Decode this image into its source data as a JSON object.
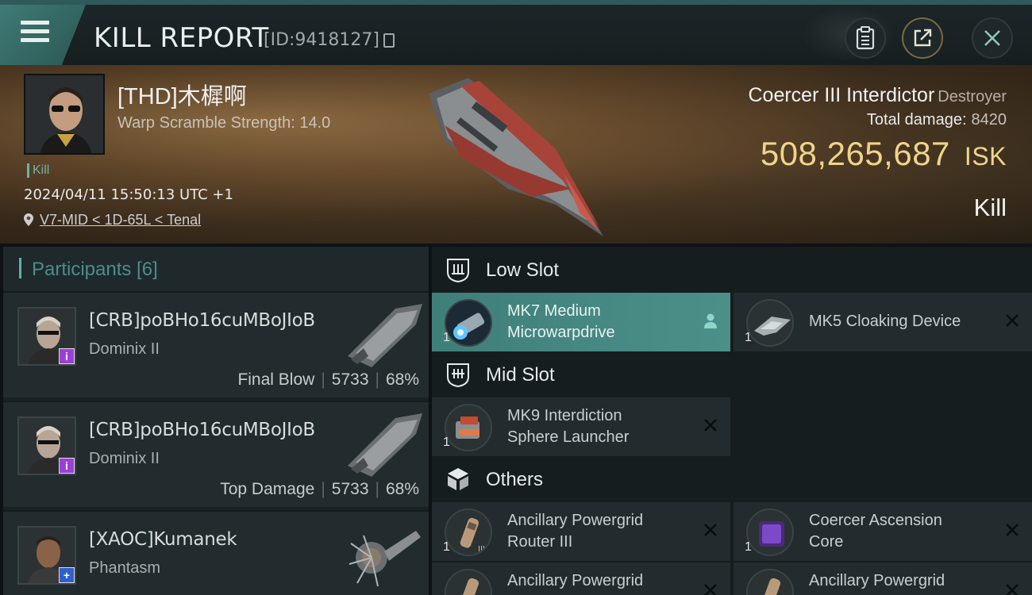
{
  "header": {
    "title": "KILL REPORT",
    "report_id": "[ID:9418127]",
    "icons": [
      "menu-icon",
      "copy-icon",
      "clipboard-icon",
      "share-icon",
      "close-icon"
    ]
  },
  "victim": {
    "name": "[THD]木樨啊",
    "warp_scramble": "Warp Scramble Strength: 14.0",
    "kill_tag": "Kill",
    "datetime": "2024/04/11 15:50:13 UTC +1",
    "location": "V7-MID < 1D-65L < Tenal",
    "ship_name": "Coercer III Interdictor",
    "ship_class": "Destroyer",
    "total_damage_label": "Total damage:",
    "total_damage": "8420",
    "isk_value": "508,265,687",
    "isk_unit": "ISK",
    "result": "Kill"
  },
  "participants": {
    "title": "Participants [6]",
    "items": [
      {
        "name": "[CRB]poBHo16cuMBoJIoB",
        "ship": "Dominix II",
        "role": "Final Blow",
        "damage": "5733",
        "percent": "68%",
        "badge": "i",
        "badge_color": "#9b3fd6"
      },
      {
        "name": "[CRB]poBHo16cuMBoJIoB",
        "ship": "Dominix II",
        "role": "Top Damage",
        "damage": "5733",
        "percent": "68%",
        "badge": "i",
        "badge_color": "#9b3fd6"
      },
      {
        "name": "[XAOC]Kumanek",
        "ship": "Phantasm",
        "role": "",
        "damage": "",
        "percent": "",
        "badge": "+",
        "badge_color": "#2f5fd0"
      }
    ]
  },
  "fitting": {
    "low_slot": {
      "label": "Low Slot",
      "modules": [
        {
          "name_line1": "MK7 Medium",
          "name_line2": "Microwarpdrive",
          "qty": "1",
          "active": true
        },
        {
          "name_line1": "MK5 Cloaking Device",
          "name_line2": "",
          "qty": "1",
          "active": false
        }
      ]
    },
    "mid_slot": {
      "label": "Mid Slot",
      "modules": [
        {
          "name_line1": "MK9 Interdiction",
          "name_line2": "Sphere Launcher",
          "qty": "1",
          "active": false
        }
      ]
    },
    "others": {
      "label": "Others",
      "modules": [
        {
          "name_line1": "Ancillary Powergrid",
          "name_line2": "Router III",
          "qty": "1",
          "active": false
        },
        {
          "name_line1": "Coercer Ascension",
          "name_line2": "Core",
          "qty": "1",
          "active": false
        },
        {
          "name_line1": "Ancillary Powergrid",
          "name_line2": "",
          "qty": "",
          "active": false
        },
        {
          "name_line1": "Ancillary Powergrid",
          "name_line2": "",
          "qty": "",
          "active": false
        }
      ]
    }
  },
  "colors": {
    "accent_teal": "#3f7f7a",
    "isk_gold": "#f0d48a",
    "badge_purple": "#9b3fd6",
    "badge_blue": "#2f5fd0"
  }
}
